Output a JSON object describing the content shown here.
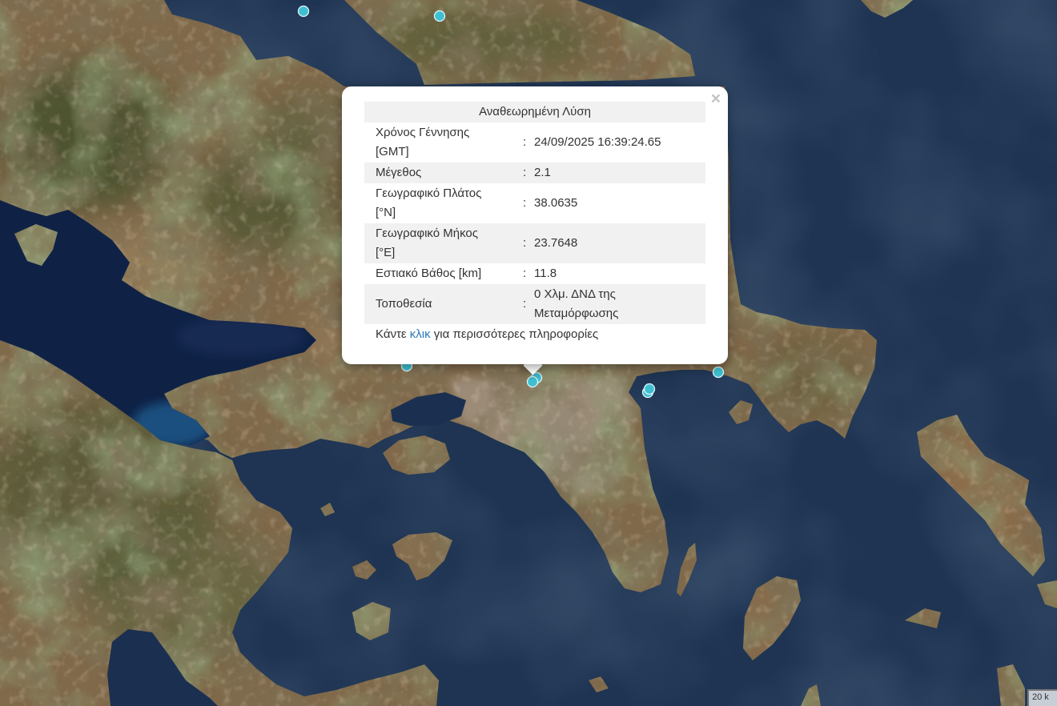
{
  "map": {
    "scale_label": "20 k"
  },
  "popup": {
    "close": "×",
    "title": "Αναθεωρημένη Λύση",
    "separator": ":",
    "rows": [
      {
        "label": "Χρόνος Γέννησης [GMT]",
        "value": "24/09/2025 16:39:24.65"
      },
      {
        "label": "Μέγεθος",
        "value": "2.1"
      },
      {
        "label": "Γεωγραφικό Πλάτος [°N]",
        "value": "38.0635"
      },
      {
        "label": "Γεωγραφικό Μήκος [°E]",
        "value": "23.7648"
      },
      {
        "label": "Εστιακό Βάθος [km]",
        "value": "11.8"
      },
      {
        "label": "Τοποθεσία",
        "value": "0 Χλμ. ΔΝΔ της Μεταμόρφωσης"
      }
    ],
    "footer": {
      "prefix": "Κάντε",
      "link": "κλικ",
      "suffix": "για περισσότερες πληροφορίες"
    }
  },
  "colors": {
    "title_green": "#2e8b2e",
    "link_blue": "#2a7ab8",
    "marker": "#3fc0d2",
    "sea": "#1e3452"
  },
  "icons": {
    "close": "close-icon",
    "marker": "earthquake-marker-icon"
  }
}
